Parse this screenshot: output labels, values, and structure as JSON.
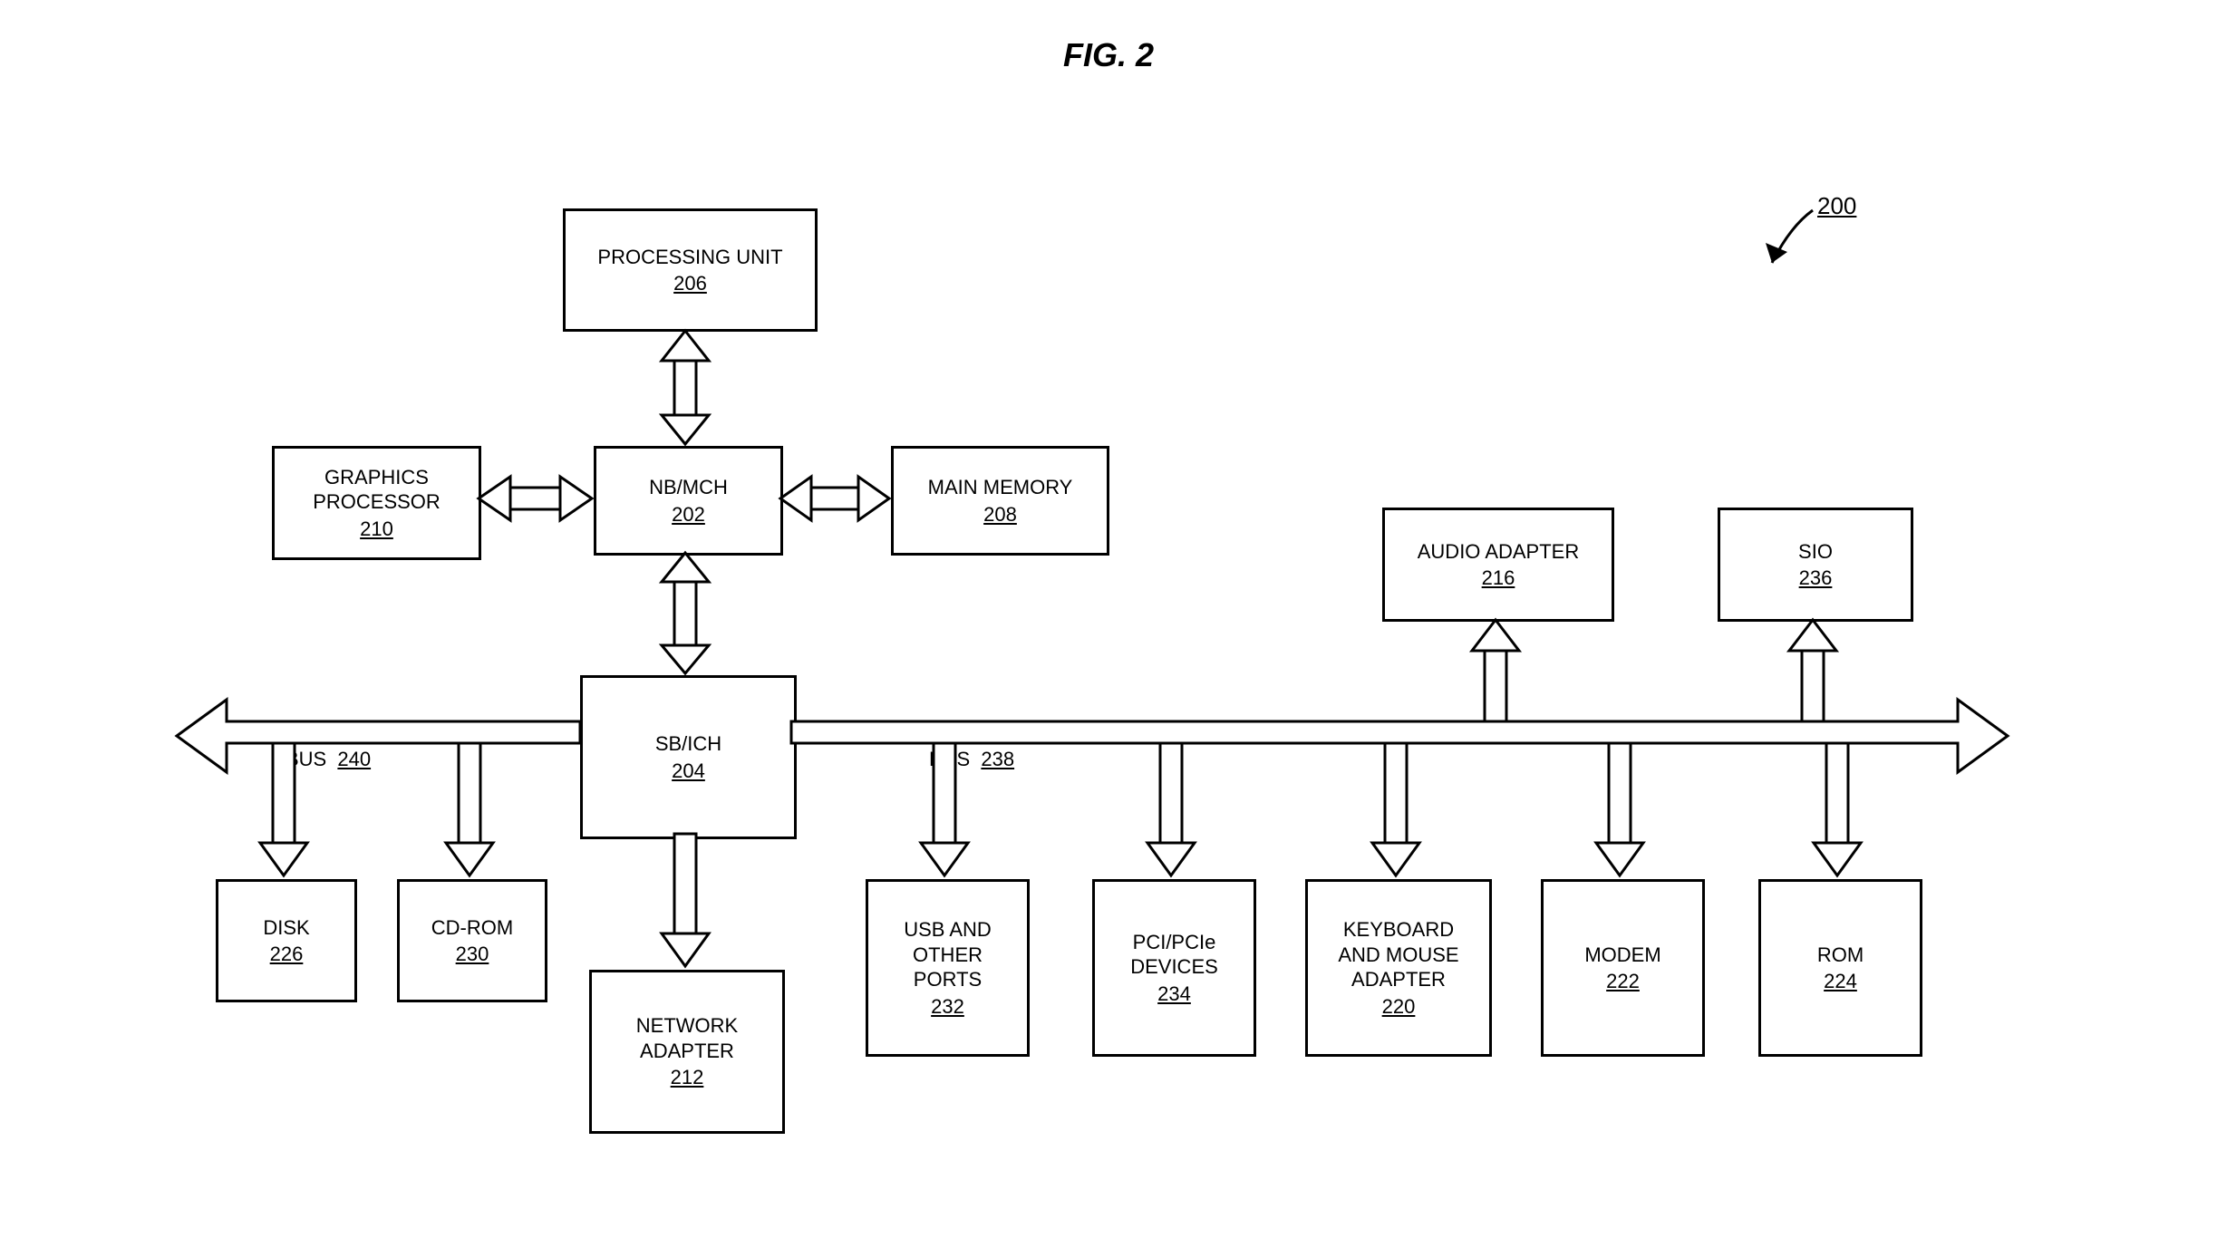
{
  "figure": {
    "title": "FIG. 2",
    "ref": "200"
  },
  "bus": {
    "left": {
      "label": "BUS",
      "ref": "240"
    },
    "right": {
      "label": "BUS",
      "ref": "238"
    }
  },
  "boxes": {
    "processing_unit": {
      "label": "PROCESSING UNIT",
      "ref": "206"
    },
    "graphics_processor": {
      "label": "GRAPHICS\nPROCESSOR",
      "ref": "210"
    },
    "nb_mch": {
      "label": "NB/MCH",
      "ref": "202"
    },
    "main_memory": {
      "label": "MAIN MEMORY",
      "ref": "208"
    },
    "sb_ich": {
      "label": "SB/ICH",
      "ref": "204"
    },
    "disk": {
      "label": "DISK",
      "ref": "226"
    },
    "cdrom": {
      "label": "CD-ROM",
      "ref": "230"
    },
    "network_adapter": {
      "label": "NETWORK\nADAPTER",
      "ref": "212"
    },
    "usb_ports": {
      "label": "USB AND\nOTHER\nPORTS",
      "ref": "232"
    },
    "pci": {
      "label": "PCI/PCIe\nDEVICES",
      "ref": "234"
    },
    "kbd_mouse": {
      "label": "KEYBOARD\nAND MOUSE\nADAPTER",
      "ref": "220"
    },
    "modem": {
      "label": "MODEM",
      "ref": "222"
    },
    "rom": {
      "label": "ROM",
      "ref": "224"
    },
    "audio": {
      "label": "AUDIO ADAPTER",
      "ref": "216"
    },
    "sio": {
      "label": "SIO",
      "ref": "236"
    }
  }
}
